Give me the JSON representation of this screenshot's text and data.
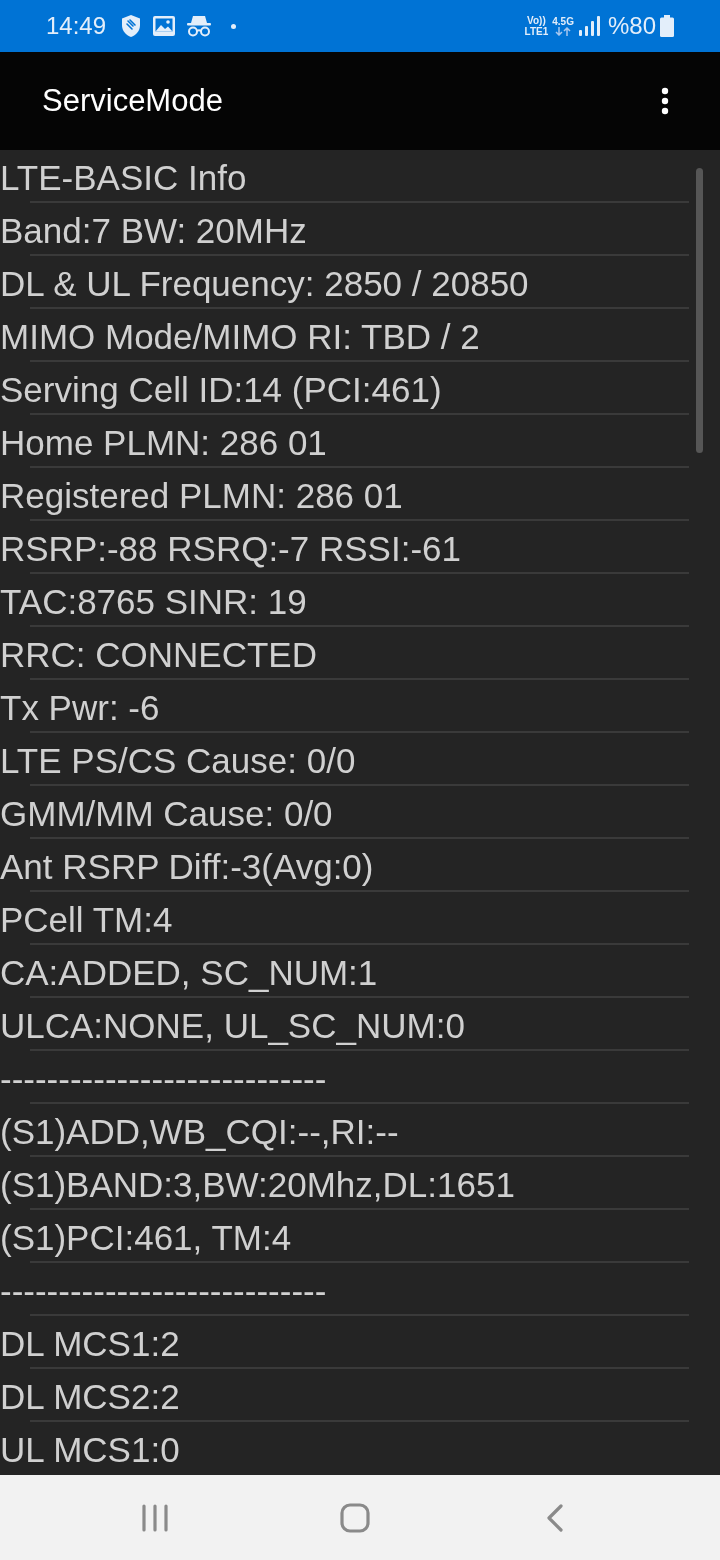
{
  "status_bar": {
    "time": "14:49",
    "volte_top": "Vo))",
    "volte_bottom": "LTE1",
    "network_type": "4.5G",
    "battery_text": "%80"
  },
  "app_bar": {
    "title": "ServiceMode"
  },
  "lines": [
    "LTE-BASIC Info",
    "Band:7 BW: 20MHz",
    "DL & UL Frequency: 2850 / 20850",
    "MIMO Mode/MIMO RI: TBD / 2",
    "Serving Cell ID:14 (PCI:461)",
    "Home PLMN: 286 01",
    "Registered PLMN: 286 01",
    "RSRP:-88 RSRQ:-7 RSSI:-61",
    "TAC:8765 SINR: 19",
    "RRC: CONNECTED",
    "Tx Pwr: -6",
    "LTE PS/CS Cause: 0/0",
    "GMM/MM Cause: 0/0",
    "Ant RSRP Diff:-3(Avg:0)",
    "PCell TM:4",
    "CA:ADDED, SC_NUM:1",
    "ULCA:NONE, UL_SC_NUM:0",
    "----------------------------",
    "(S1)ADD,WB_CQI:--,RI:--",
    "(S1)BAND:3,BW:20Mhz,DL:1651",
    "(S1)PCI:461, TM:4",
    "----------------------------",
    "DL MCS1:2",
    "DL MCS2:2",
    "UL MCS1:0"
  ]
}
